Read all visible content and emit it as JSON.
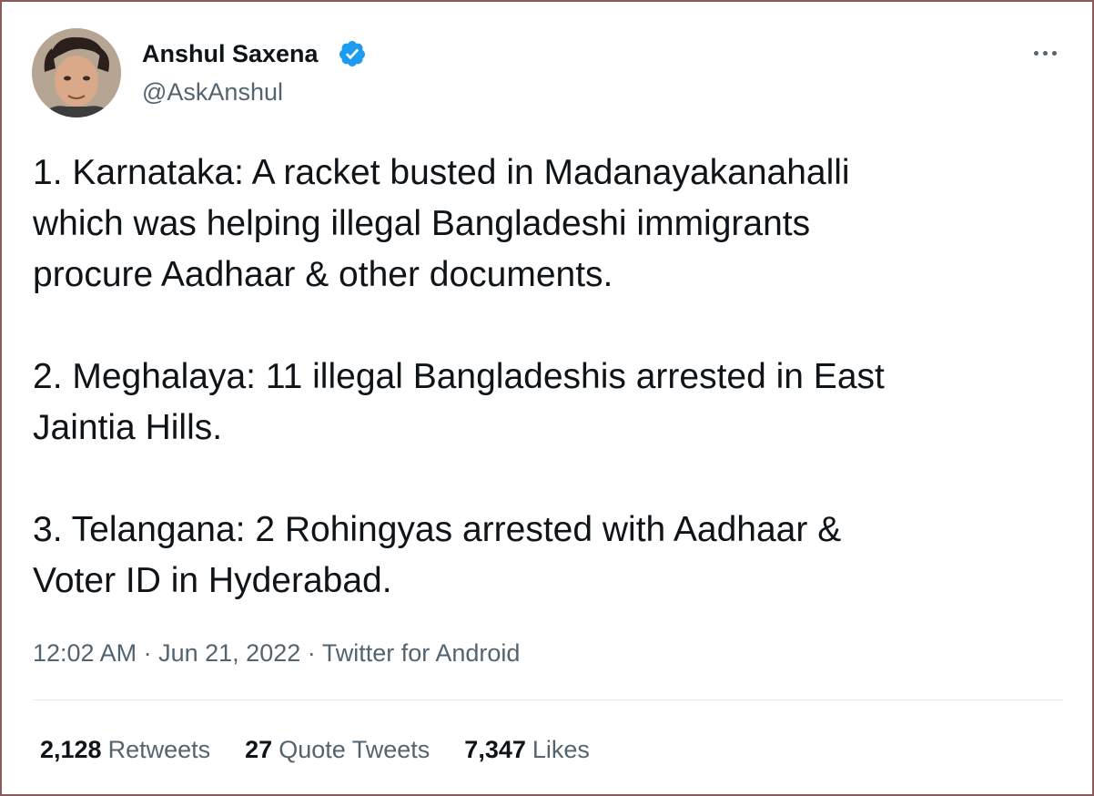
{
  "author": {
    "name": "Anshul Saxena",
    "handle": "@AskAnshul",
    "verified": true,
    "avatar_icon": "user-avatar"
  },
  "tweet": {
    "paragraphs": [
      [
        "1. Karnataka: A racket busted in Madanayakanahalli",
        "which was helping illegal Bangladeshi immigrants",
        "procure Aadhaar & other documents."
      ],
      [
        "2. Meghalaya: 11 illegal Bangladeshis arrested in East",
        "Jaintia Hills."
      ],
      [
        "3. Telangana: 2 Rohingyas arrested with Aadhaar &",
        "Voter ID in Hyderabad."
      ]
    ],
    "time": "12:02 AM",
    "date": "Jun 21, 2022",
    "source": "Twitter for Android",
    "separator": "·"
  },
  "stats": {
    "retweets_count": "2,128",
    "retweets_label": "Retweets",
    "quotes_count": "27",
    "quotes_label": "Quote Tweets",
    "likes_count": "7,347",
    "likes_label": "Likes"
  },
  "colors": {
    "text": "#0f1419",
    "secondary": "#536471",
    "verified_blue": "#1d9bf0",
    "frame_border": "#8a5a5a"
  }
}
